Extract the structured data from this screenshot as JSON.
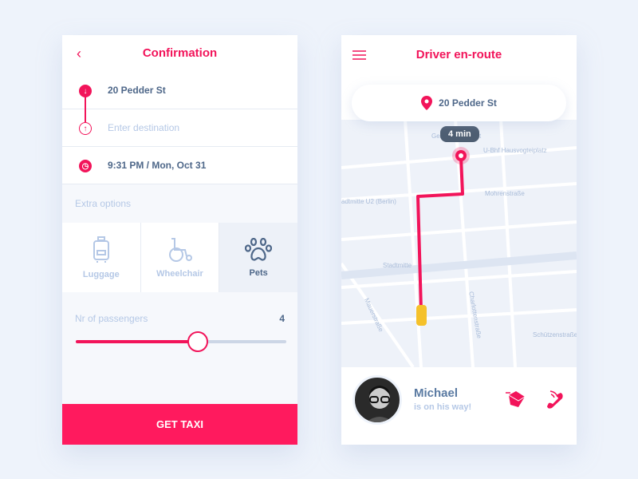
{
  "confirmation": {
    "title": "Confirmation",
    "back_icon": "chevron-left-icon",
    "pickup": "20 Pedder St",
    "destination_placeholder": "Enter destination",
    "time": "9:31 PM / Mon, Oct 31",
    "extra_options_label": "Extra options",
    "options": [
      {
        "label": "Luggage",
        "icon": "luggage-icon",
        "selected": false
      },
      {
        "label": "Wheelchair",
        "icon": "wheelchair-icon",
        "selected": false
      },
      {
        "label": "Pets",
        "icon": "paw-icon",
        "selected": true
      }
    ],
    "passengers_label": "Nr of passengers",
    "passengers": "4",
    "passengers_slider_fraction": 0.58,
    "cta": "GET TAXI"
  },
  "driver_view": {
    "title": "Driver en-route",
    "menu_icon": "hamburger-icon",
    "location": "20 Pedder St",
    "eta": "4 min",
    "map_labels": [
      "Gendarmenmarkt",
      "U-Bhf Hausvogteiplatz",
      "Mohrenstraße",
      "adtmitte U2 (Berlin)",
      "Stadtmitte",
      "Charlottenstraße",
      "Mauerstraße",
      "Schützenstraße"
    ],
    "driver_name": "Michael",
    "driver_status": "is on his way!"
  },
  "colors": {
    "accent": "#f2145a",
    "text": "#4e6789",
    "muted": "#b5c8e6"
  }
}
